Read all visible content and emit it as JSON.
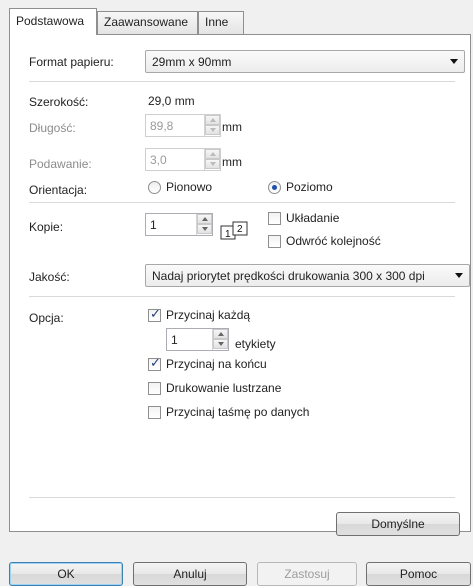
{
  "tabs": [
    {
      "label": "Podstawowa",
      "active": true
    },
    {
      "label": "Zaawansowane",
      "active": false
    },
    {
      "label": "Inne",
      "active": false
    }
  ],
  "paper_format": {
    "label": "Format papieru:",
    "value": "29mm x 90mm"
  },
  "width": {
    "label": "Szerokość:",
    "value": "29,0 mm"
  },
  "length": {
    "label": "Długość:",
    "value": "89,8",
    "unit": "mm"
  },
  "feed": {
    "label": "Podawanie:",
    "value": "3,0",
    "unit": "mm"
  },
  "orientation": {
    "label": "Orientacja:",
    "options": [
      {
        "label": "Pionowo",
        "selected": false
      },
      {
        "label": "Poziomo",
        "selected": true
      }
    ]
  },
  "copies": {
    "label": "Kopie:",
    "value": "1",
    "collate": {
      "label": "Układanie",
      "checked": false
    },
    "reverse": {
      "label": "Odwróć kolejność",
      "checked": false
    }
  },
  "quality": {
    "label": "Jakość:",
    "value": "Nadaj priorytet prędkości drukowania 300 x 300 dpi"
  },
  "options": {
    "label": "Opcja:",
    "cut_every": {
      "label": "Przycinaj każdą",
      "checked": true
    },
    "cut_count": "1",
    "labels_unit": "etykiety",
    "cut_at_end": {
      "label": "Przycinaj na końcu",
      "checked": true
    },
    "mirror": {
      "label": "Drukowanie lustrzane",
      "checked": false
    },
    "cut_tape": {
      "label": "Przycinaj taśmę po danych",
      "checked": false
    }
  },
  "defaults_button": "Domyślne",
  "footer": {
    "ok": "OK",
    "cancel": "Anuluj",
    "apply": "Zastosuj",
    "help": "Pomoc"
  },
  "colors": {
    "accent": "#1f4fa8",
    "check": "#2a3f7a"
  }
}
